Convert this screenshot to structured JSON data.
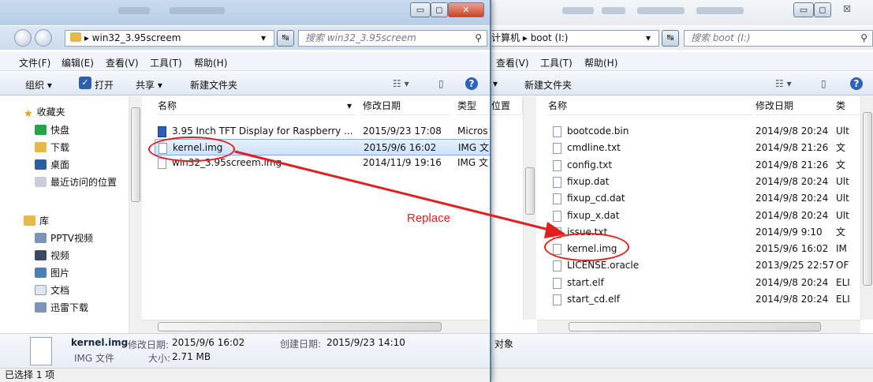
{
  "left_window": {
    "address": {
      "crumb": "win32_3.95screem",
      "search_placeholder": "搜索 win32_3.95screem"
    },
    "menu": [
      "文件(F)",
      "编辑(E)",
      "查看(V)",
      "工具(T)",
      "帮助(H)"
    ],
    "toolbar": {
      "organize": "组织 ▾",
      "open": "打开",
      "share": "共享 ▾",
      "new_folder": "新建文件夹"
    },
    "nav": {
      "favorites": "收藏夹",
      "quick": "快盘",
      "downloads": "下载",
      "desktop": "桌面",
      "recent": "最近访问的位置",
      "library": "库",
      "pptv": "PPTV视频",
      "video": "视频",
      "pictures": "图片",
      "docs": "文档",
      "xunlei": "迅雷下载"
    },
    "columns": {
      "name": "名称",
      "date": "修改日期",
      "type": "类型"
    },
    "files": [
      {
        "name": "3.95 Inch TFT Display for Raspberry ...",
        "date": "2015/9/23 17:08",
        "type": "Micros"
      },
      {
        "name": "kernel.img",
        "date": "2015/9/6 16:02",
        "type": "IMG 文"
      },
      {
        "name": "win32_3.95screem.img",
        "date": "2014/11/9 19:16",
        "type": "IMG 文"
      }
    ],
    "details": {
      "name": "kernel.img",
      "modified_label": "修改日期:",
      "modified": "2015/9/6 16:02",
      "created_label": "创建日期:",
      "created": "2015/9/23 14:10",
      "type": "IMG 文件",
      "size_label": "大小:",
      "size": "2.71 MB"
    },
    "status": "已选择 1 项"
  },
  "right_window": {
    "address": {
      "crumb_prefix": "计算机",
      "crumb": "boot (I:)",
      "search_placeholder": "搜索 boot (I:)"
    },
    "menu": [
      "查看(V)",
      "工具(T)",
      "帮助(H)"
    ],
    "toolbar": {
      "new_folder": "新建文件夹"
    },
    "columns": {
      "left_stub": "位置",
      "name": "名称",
      "date": "修改日期",
      "type": "类"
    },
    "files": [
      {
        "name": "bootcode.bin",
        "date": "2014/9/8 20:24",
        "type": "Ult"
      },
      {
        "name": "cmdline.txt",
        "date": "2014/9/8 21:26",
        "type": "文"
      },
      {
        "name": "config.txt",
        "date": "2014/9/8 21:26",
        "type": "文"
      },
      {
        "name": "fixup.dat",
        "date": "2014/9/8 20:24",
        "type": "Ult"
      },
      {
        "name": "fixup_cd.dat",
        "date": "2014/9/8 20:24",
        "type": "Ult"
      },
      {
        "name": "fixup_x.dat",
        "date": "2014/9/8 20:24",
        "type": "Ult"
      },
      {
        "name": "issue.txt",
        "date": "2014/9/9 9:10",
        "type": "文"
      },
      {
        "name": "kernel.img",
        "date": "2015/9/6 16:02",
        "type": "IM"
      },
      {
        "name": "LICENSE.oracle",
        "date": "2013/9/25 22:57",
        "type": "OF"
      },
      {
        "name": "start.elf",
        "date": "2014/9/8 20:24",
        "type": "ELI"
      },
      {
        "name": "start_cd.elf",
        "date": "2014/9/8 20:24",
        "type": "ELI"
      }
    ],
    "details_stub": "对象"
  },
  "annotation": {
    "text": "Replace",
    "color": "#e02020"
  },
  "colors": {
    "accent": "#84acdd",
    "annotation": "#e02020"
  },
  "icons": [
    "back-icon",
    "forward-icon",
    "folder-icon",
    "refresh-icon",
    "search-icon",
    "shield-icon",
    "view-icon",
    "pane-icon",
    "help-icon",
    "star-icon",
    "file-icon",
    "word-doc-icon"
  ]
}
